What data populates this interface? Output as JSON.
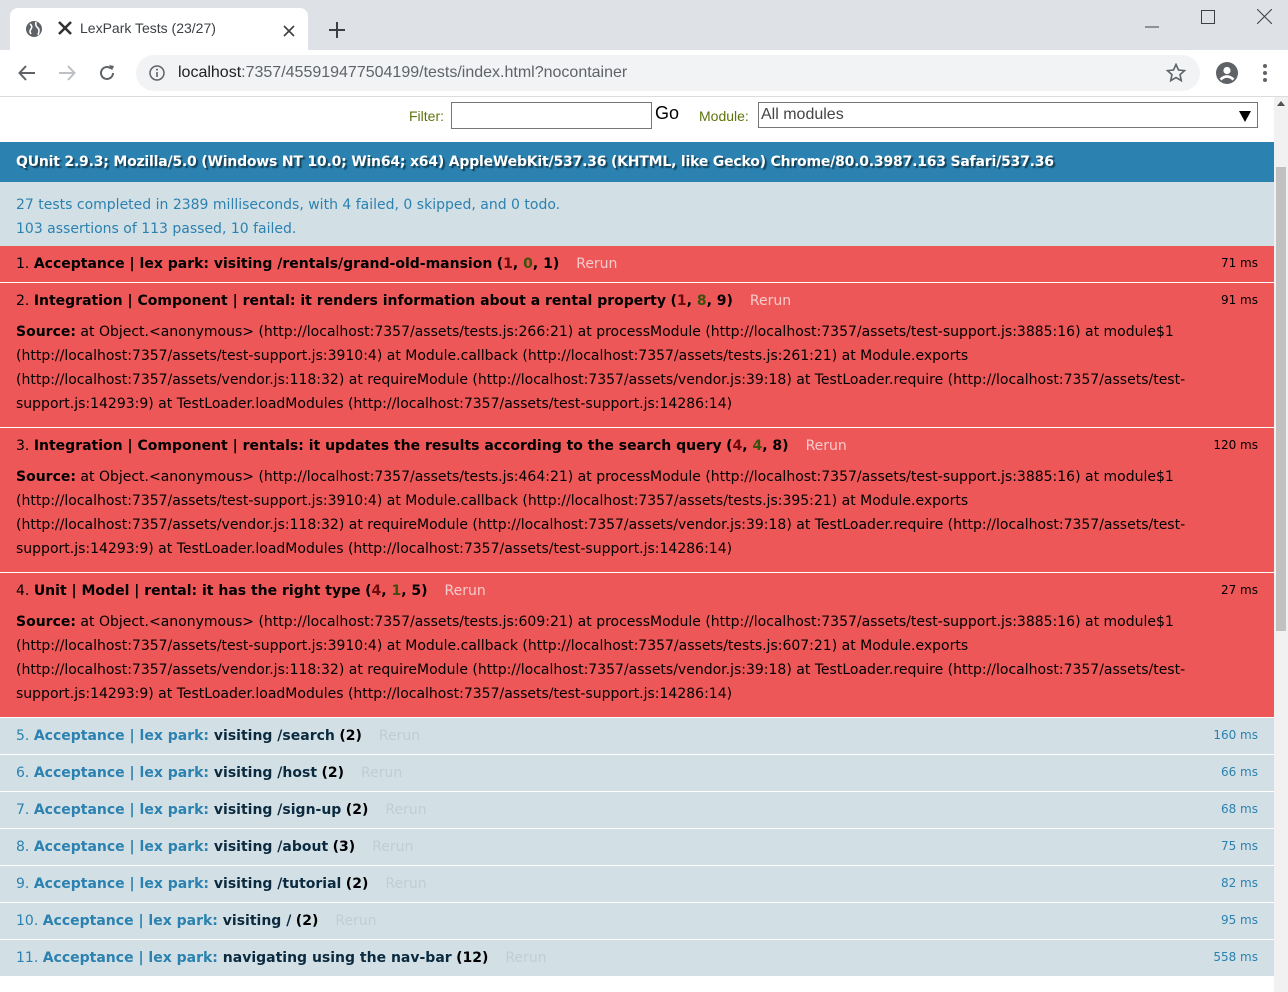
{
  "browser": {
    "tab_title": "LexPark Tests (23/27)",
    "url_host": "localhost",
    "url_rest": ":7357/455919477504199/tests/index.html?nocontainer"
  },
  "toolbar": {
    "filter_label": "Filter:",
    "filter_value": "",
    "go_label": "Go",
    "module_label": "Module:",
    "module_selected": "All modules"
  },
  "qunit": {
    "user_agent": "QUnit 2.9.3; Mozilla/5.0 (Windows NT 10.0; Win64; x64) AppleWebKit/537.36 (KHTML, like Gecko) Chrome/80.0.3987.163 Safari/537.36",
    "summary_line1": "27 tests completed in 2389 milliseconds, with 4 failed, 0 skipped, and 0 todo.",
    "summary_line2": "103 assertions of 113 passed, 10 failed."
  },
  "rerun_label": "Rerun",
  "source_label": "Source:",
  "tests": [
    {
      "status": "fail",
      "num": "1. ",
      "module": "Acceptance | lex park: visiting /rentals/grand-old-mansion",
      "name": "",
      "failed": "1",
      "passed": "0",
      "total": "1",
      "runtime": "71 ms",
      "source": ""
    },
    {
      "status": "fail",
      "num": "2. ",
      "module": "Integration | Component | rental: it renders information about a rental property",
      "name": "",
      "failed": "1",
      "passed": "8",
      "total": "9",
      "runtime": "91 ms",
      "source": "at Object.<anonymous> (http://localhost:7357/assets/tests.js:266:21) at processModule (http://localhost:7357/assets/test-support.js:3885:16) at module$1 (http://localhost:7357/assets/test-support.js:3910:4) at Module.callback (http://localhost:7357/assets/tests.js:261:21) at Module.exports (http://localhost:7357/assets/vendor.js:118:32) at requireModule (http://localhost:7357/assets/vendor.js:39:18) at TestLoader.require (http://localhost:7357/assets/test-support.js:14293:9) at TestLoader.loadModules (http://localhost:7357/assets/test-support.js:14286:14)"
    },
    {
      "status": "fail",
      "num": "3. ",
      "module": "Integration | Component | rentals: it updates the results according to the search query",
      "name": "",
      "failed": "4",
      "passed": "4",
      "total": "8",
      "runtime": "120 ms",
      "source": "at Object.<anonymous> (http://localhost:7357/assets/tests.js:464:21) at processModule (http://localhost:7357/assets/test-support.js:3885:16) at module$1 (http://localhost:7357/assets/test-support.js:3910:4) at Module.callback (http://localhost:7357/assets/tests.js:395:21) at Module.exports (http://localhost:7357/assets/vendor.js:118:32) at requireModule (http://localhost:7357/assets/vendor.js:39:18) at TestLoader.require (http://localhost:7357/assets/test-support.js:14293:9) at TestLoader.loadModules (http://localhost:7357/assets/test-support.js:14286:14)"
    },
    {
      "status": "fail",
      "num": "4. ",
      "module": "Unit | Model | rental: it has the right type",
      "name": "",
      "failed": "4",
      "passed": "1",
      "total": "5",
      "runtime": "27 ms",
      "source": "at Object.<anonymous> (http://localhost:7357/assets/tests.js:609:21) at processModule (http://localhost:7357/assets/test-support.js:3885:16) at module$1 (http://localhost:7357/assets/test-support.js:3910:4) at Module.callback (http://localhost:7357/assets/tests.js:607:21) at Module.exports (http://localhost:7357/assets/vendor.js:118:32) at requireModule (http://localhost:7357/assets/vendor.js:39:18) at TestLoader.require (http://localhost:7357/assets/test-support.js:14293:9) at TestLoader.loadModules (http://localhost:7357/assets/test-support.js:14286:14)"
    },
    {
      "status": "pass",
      "num": "5. ",
      "module": "Acceptance | lex park:",
      "name": " visiting /search",
      "total": "2",
      "runtime": "160 ms"
    },
    {
      "status": "pass",
      "num": "6. ",
      "module": "Acceptance | lex park:",
      "name": " visiting /host",
      "total": "2",
      "runtime": "66 ms"
    },
    {
      "status": "pass",
      "num": "7. ",
      "module": "Acceptance | lex park:",
      "name": " visiting /sign-up",
      "total": "2",
      "runtime": "68 ms"
    },
    {
      "status": "pass",
      "num": "8. ",
      "module": "Acceptance | lex park:",
      "name": " visiting /about",
      "total": "3",
      "runtime": "75 ms"
    },
    {
      "status": "pass",
      "num": "9. ",
      "module": "Acceptance | lex park:",
      "name": " visiting /tutorial",
      "total": "2",
      "runtime": "82 ms"
    },
    {
      "status": "pass",
      "num": "10. ",
      "module": "Acceptance | lex park:",
      "name": " visiting /",
      "total": "2",
      "runtime": "95 ms"
    },
    {
      "status": "pass",
      "num": "11. ",
      "module": "Acceptance | lex park:",
      "name": " navigating using the nav-bar",
      "total": "12",
      "runtime": "558 ms"
    }
  ],
  "colors": {
    "header_blue": "#2b81af",
    "fail_red": "#ee5757",
    "pass_bg": "#d2e0e6",
    "label_green": "#5e740b"
  },
  "icons": [
    "globe-icon",
    "tomster-favicon-icon",
    "close-icon",
    "plus-icon",
    "minimize-icon",
    "maximize-icon",
    "window-close-icon",
    "back-icon",
    "forward-icon",
    "reload-icon",
    "info-icon",
    "star-icon",
    "profile-icon",
    "kebab-menu-icon",
    "dropdown-arrow-icon"
  ]
}
